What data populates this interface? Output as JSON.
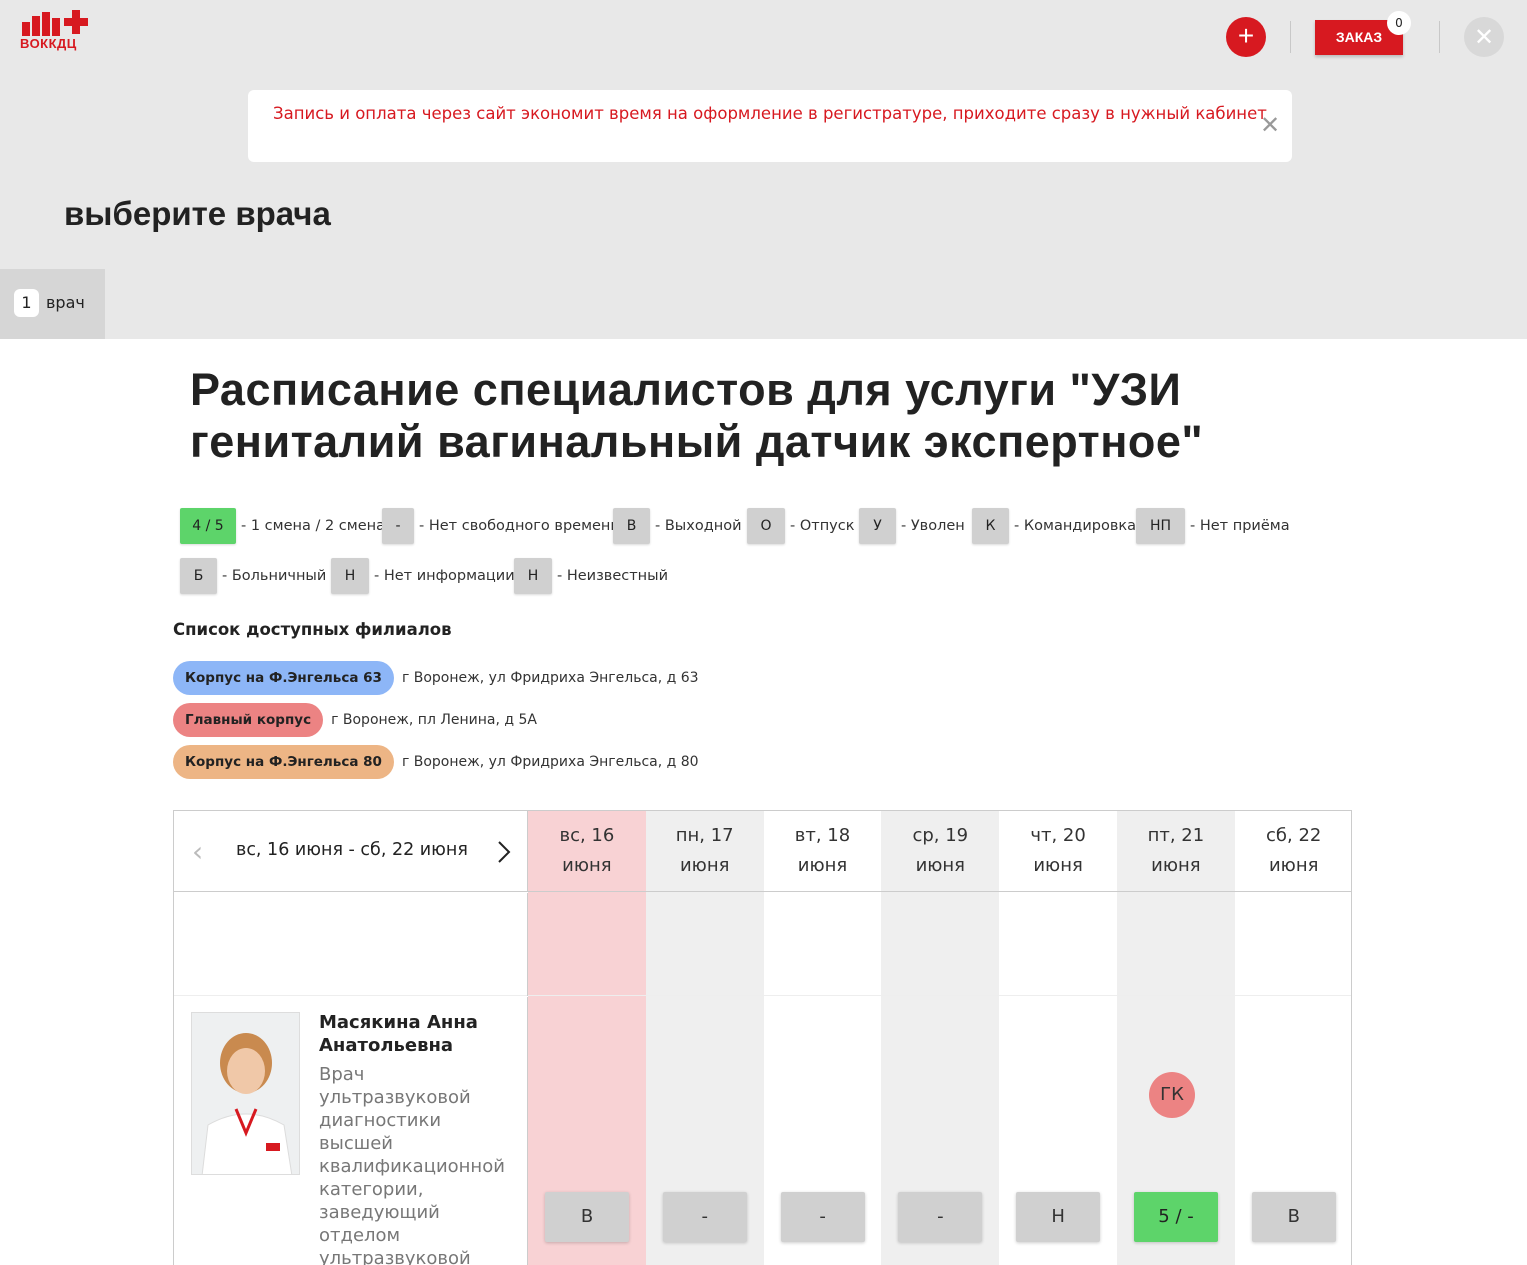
{
  "header": {
    "logo_text": "ВОККДЦ",
    "add_icon": "plus-icon",
    "order_label": "ЗАКАЗ",
    "order_count": "0",
    "close_icon": "close-icon"
  },
  "notice": {
    "text": "Запись и оплата через сайт экономит время на оформление в регистратуре, приходите сразу в нужный кабинет",
    "close_icon": "close-icon"
  },
  "step": {
    "heading": "выберите врача",
    "tab_number": "1",
    "tab_label": "врач"
  },
  "schedule": {
    "title": "Расписание специалистов для услуги \"УЗИ гениталий вагинальный датчик экспертное\""
  },
  "legend": [
    {
      "code": "4 / 5",
      "label": "- 1 смена / 2 смена",
      "green": true
    },
    {
      "code": "-",
      "label": "- Нет свободного времени"
    },
    {
      "code": "В",
      "label": "- Выходной"
    },
    {
      "code": "О",
      "label": "- Отпуск"
    },
    {
      "code": "У",
      "label": "- Уволен"
    },
    {
      "code": "К",
      "label": "- Командировка"
    },
    {
      "code": "НП",
      "label": "- Нет приёма"
    },
    {
      "code": "Б",
      "label": "- Больничный"
    },
    {
      "code": "Н",
      "label": "- Нет информации"
    },
    {
      "code": "Н",
      "label": "- Неизвестный"
    }
  ],
  "branches": {
    "title": "Список доступных филиалов",
    "items": [
      {
        "name": "Корпус на Ф.Энгельса 63",
        "address": "г Воронеж, ул Фридриха Энгельса, д 63",
        "color": "#8db6f7"
      },
      {
        "name": "Главный корпус",
        "address": "г Воронеж, пл Ленина, д 5А",
        "color": "#ec8383"
      },
      {
        "name": "Корпус на Ф.Энгельса 80",
        "address": "г Воронеж, ул Фридриха Энгельса, д 80",
        "color": "#edb585"
      }
    ]
  },
  "calendar": {
    "week_label": "вс, 16 июня - сб, 22 июня",
    "prev_icon": "chevron-left-icon",
    "next_icon": "chevron-right-icon",
    "days": [
      {
        "weekday": "вс, 16",
        "month": "июня",
        "bg": "#f8d2d4"
      },
      {
        "weekday": "пн, 17",
        "month": "июня",
        "bg": "#efefef"
      },
      {
        "weekday": "вт, 18",
        "month": "июня",
        "bg": "#ffffff"
      },
      {
        "weekday": "ср, 19",
        "month": "июня",
        "bg": "#efefef"
      },
      {
        "weekday": "чт, 20",
        "month": "июня",
        "bg": "#ffffff"
      },
      {
        "weekday": "пт, 21",
        "month": "июня",
        "bg": "#efefef"
      },
      {
        "weekday": "сб, 22",
        "month": "июня",
        "bg": "#ffffff"
      }
    ]
  },
  "doctor": {
    "name": "Масякина Анна Анатольевна",
    "description": "Врач ультразвуковой диагностики высшей квалификационной категории, заведующий отделом ультразвуковой",
    "cells": [
      "В",
      "-",
      "-",
      "-",
      "Н",
      "5 / -",
      "В"
    ],
    "cell_green": [
      false,
      false,
      false,
      false,
      false,
      true,
      false
    ],
    "branch_marker": {
      "day_index": 5,
      "text": "ГК",
      "color": "#ec8383"
    }
  }
}
